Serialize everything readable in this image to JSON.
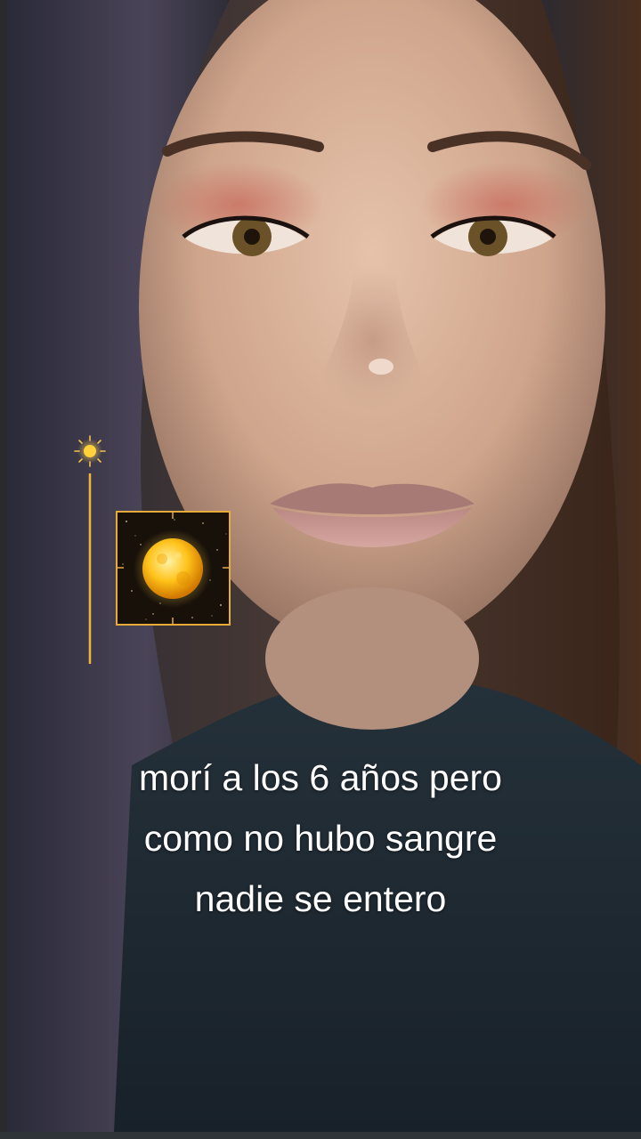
{
  "video": {
    "caption_lines": [
      "morí a los 6 años pero",
      "como no hubo sangre",
      "nadie se entero"
    ]
  },
  "effect": {
    "icons": [
      "sun-icon",
      "moon-icon"
    ],
    "accent_color": "#f5b41e"
  }
}
